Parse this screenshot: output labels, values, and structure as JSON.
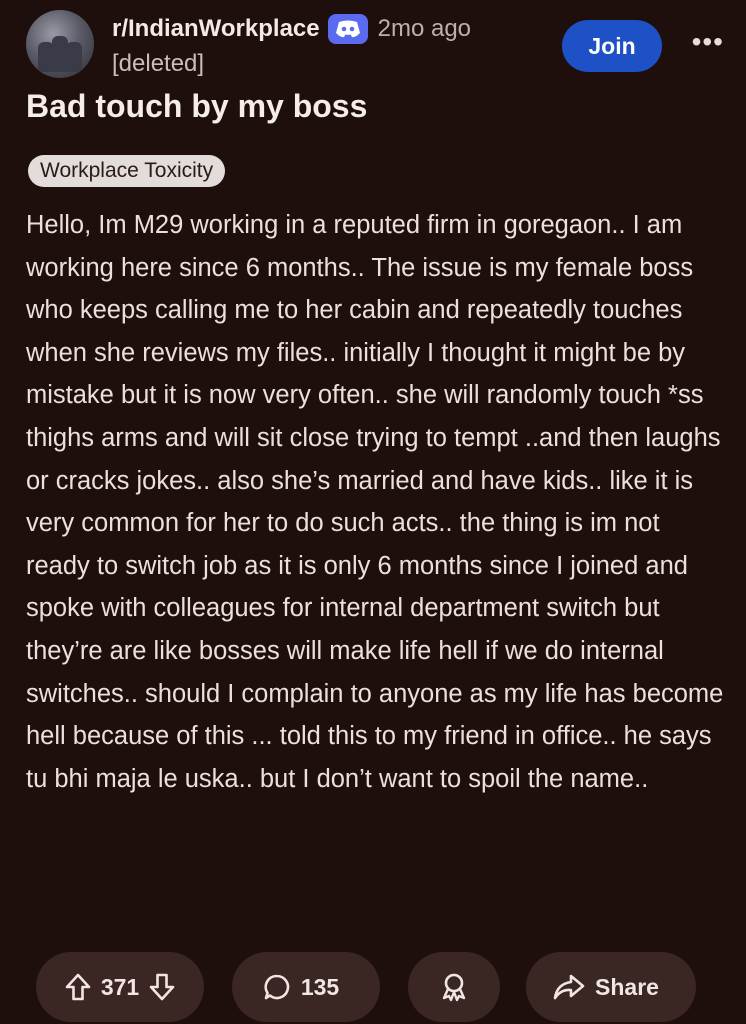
{
  "post": {
    "subreddit": "r/IndianWorkplace",
    "time": "2mo ago",
    "author": "[deleted]",
    "join_label": "Join",
    "more_label": "•••",
    "title": "Bad touch by my boss",
    "flair": "Workplace Toxicity",
    "body": "Hello, Im M29 working in a reputed firm in goregaon.. I am working here since 6 months.. The issue is my female boss who keeps calling me to her cabin and repeatedly touches when she reviews my files.. initially I thought it might be by mistake but it is now very often.. she will randomly touch *ss thighs arms and will sit close trying to tempt ..and then laughs or cracks jokes.. also she’s married and have kids.. like it is very common for her to do such acts.. the thing is im not ready to switch job as it is only 6 months since I joined and spoke with colleagues for internal department switch but they’re are like bosses will make life hell if we do internal switches.. should I complain to anyone as my life has become hell because of this ... told this to my friend in office.. he says tu bhi maja le uska.. but I don’t want to spoil the name.."
  },
  "actions": {
    "upvotes": "371",
    "comments": "135",
    "share_label": "Share"
  },
  "icons": {
    "discord": "discord-icon",
    "upvote": "arrow-up-icon",
    "downvote": "arrow-down-icon",
    "comment": "speech-bubble-icon",
    "award": "award-icon",
    "share": "share-arrow-icon"
  },
  "colors": {
    "background": "#1e0f0c",
    "join_button": "#1e50c6",
    "pill": "#3a2622",
    "flair": "#e2dcda",
    "discord": "#5b6bf0"
  }
}
